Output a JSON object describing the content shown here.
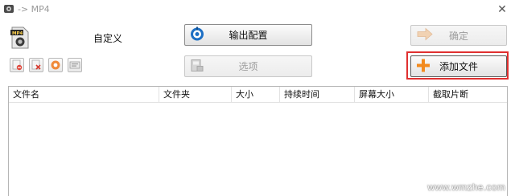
{
  "window": {
    "title": "-> MP4",
    "close_glyph": "✕"
  },
  "format": {
    "label": "自定义",
    "icon": "mp4-file-icon"
  },
  "buttons": {
    "output_config": "输出配置",
    "options": "选项",
    "ok": "确定",
    "add_file": "添加文件"
  },
  "toolbar": {
    "icons": [
      "remove-file-icon",
      "clear-list-icon",
      "play-icon",
      "media-info-icon"
    ]
  },
  "file_list": {
    "columns": [
      "文件名",
      "文件夹",
      "大小",
      "持续时间",
      "屏幕大小",
      "截取片断"
    ],
    "rows": []
  },
  "watermark": "www.wmzhe.com",
  "colors": {
    "highlight_outline": "#e03030",
    "add_icon": "#f28a1e",
    "output_icon": "#1d6fc4"
  }
}
